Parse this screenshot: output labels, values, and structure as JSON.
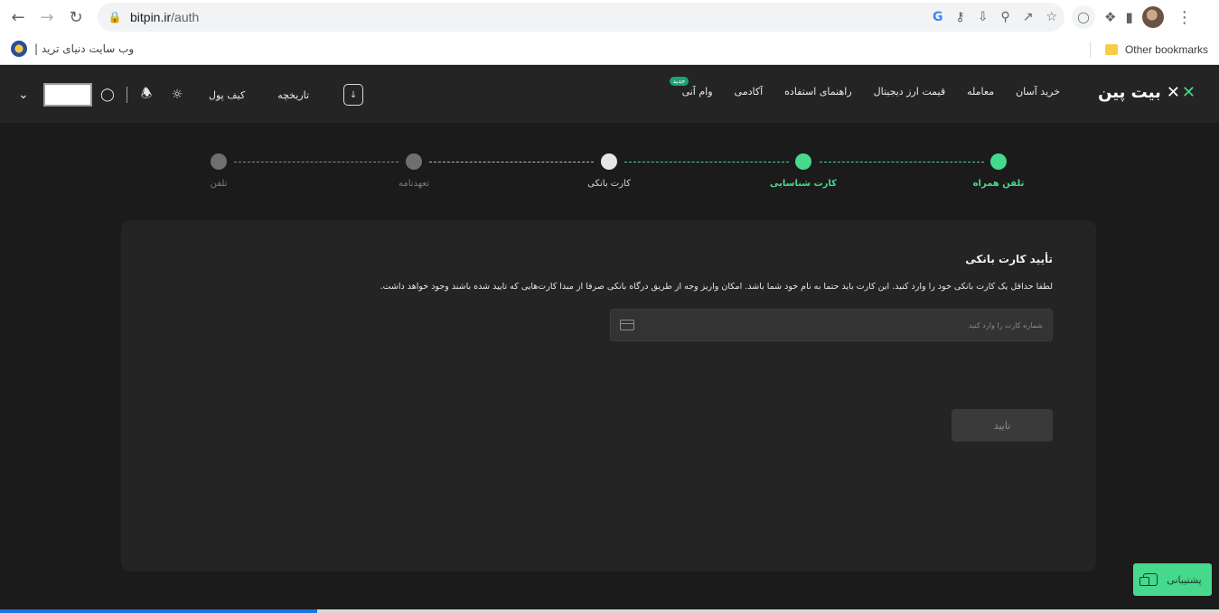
{
  "browser": {
    "url_host": "bitpin.ir",
    "url_path": "/auth",
    "bookmark_label": "وب سایت دنیای ترید |",
    "other_bookmarks": "Other bookmarks",
    "load_progress": 0.26
  },
  "header": {
    "logo_text": "بیت پین",
    "nav": [
      {
        "label": "خرید آسان"
      },
      {
        "label": "معامله"
      },
      {
        "label": "قیمت ارز دیجیتال"
      },
      {
        "label": "راهنمای استفاده"
      },
      {
        "label": "آکادمی"
      },
      {
        "label": "وام آنی",
        "badge": "جدید"
      }
    ],
    "wallet_label": "کیف پول",
    "history_label": "تاریخچه",
    "icons": [
      "chevron-down-icon",
      "user-icon",
      "bell-icon",
      "sun-icon",
      "phone-download-icon"
    ]
  },
  "stepper": {
    "steps": [
      {
        "label": "تلفن همراه",
        "state": "done"
      },
      {
        "label": "کارت شناسایی",
        "state": "done"
      },
      {
        "label": "کارت بانکی",
        "state": "current"
      },
      {
        "label": "تعهدنامه",
        "state": "pending"
      },
      {
        "label": "تلفن",
        "state": "pending"
      }
    ]
  },
  "card": {
    "title": "تأیید کارت بانکی",
    "description": "لطفا حداقل یک کارت بانکی خود را وارد کنید. این کارت باید حتما به نام خود شما باشد. امکان واریز وجه از طریق درگاه بانکی صرفا از مبدا کارت‌هایی که تایید شده باشند وجود خواهد داشت.",
    "card_input_placeholder": "شماره کارت را وارد کنید",
    "submit_label": "تایید"
  },
  "support": {
    "label": "پشتیبانی"
  },
  "colors": {
    "accent": "#46d98d",
    "done": "#46d98d",
    "current": "#e6e6e6",
    "pending": "#6f6f6f"
  }
}
